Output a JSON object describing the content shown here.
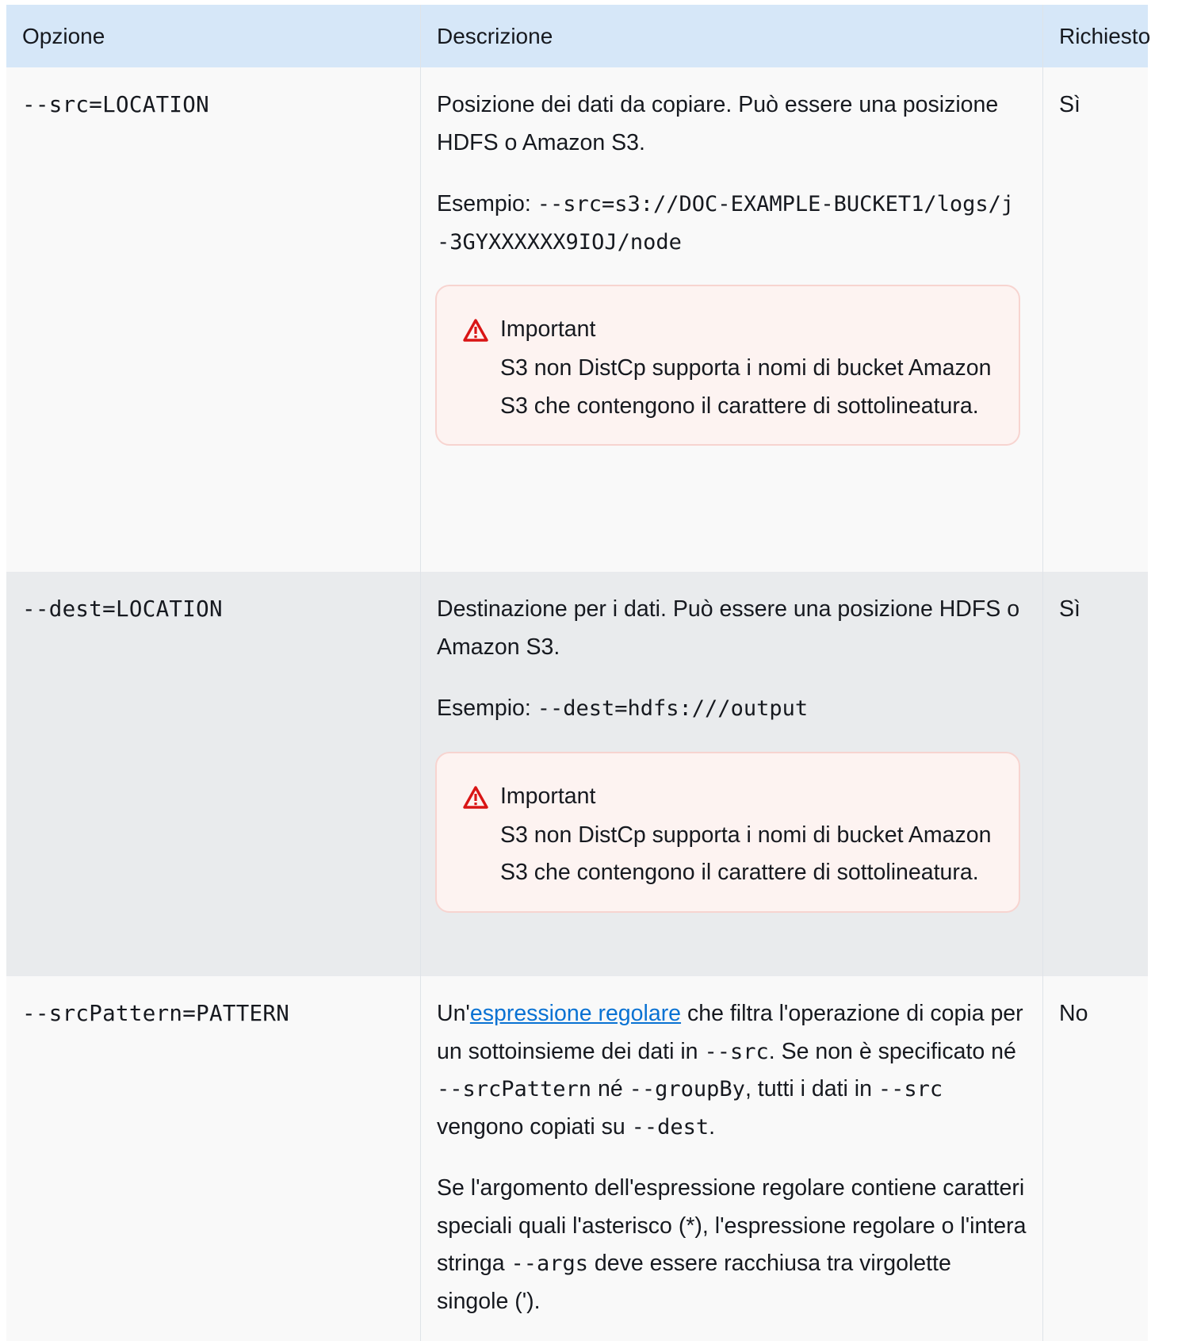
{
  "table": {
    "headers": {
      "option": "Opzione",
      "description": "Descrizione",
      "required": "Richiesto"
    },
    "rows": [
      {
        "option": "--src=LOCATION",
        "description": "Posizione dei dati da copiare. Può essere una posizione HDFS o Amazon S3.",
        "example_label": "Esempio: ",
        "example_code": "--src=s3://DOC-EXAMPLE-BUCKET1/logs/j-3GYXXXXXX9IOJ/node",
        "alert_title": "Important",
        "alert_text": "S3 non DistCp supporta i nomi di bucket Amazon S3 che contengono il carattere di sottolineatura.",
        "required": "Sì"
      },
      {
        "option": "--dest=LOCATION",
        "description": "Destinazione per i dati. Può essere una posizione HDFS o Amazon S3.",
        "example_label": "Esempio: ",
        "example_code": "--dest=hdfs:///output",
        "alert_title": "Important",
        "alert_text": "S3 non DistCp supporta i nomi di bucket Amazon S3 che contengono il carattere di sottolineatura.",
        "required": "Sì"
      },
      {
        "option": "--srcPattern=PATTERN",
        "desc_prefix": "Un'",
        "desc_link": "espressione regolare",
        "desc_mid1": " che filtra l'operazione di copia per un sottoinsieme dei dati in ",
        "code_src": "--src",
        "desc_mid2": ". Se non è specificato né ",
        "code_srcPattern": "--srcPattern",
        "desc_mid3": " né ",
        "code_groupBy": "--groupBy",
        "desc_mid4": ", tutti i dati in ",
        "desc_mid5": " vengono copiati su ",
        "code_dest": "--dest",
        "desc_end": ".",
        "para2_a": "Se l'argomento dell'espressione regolare contiene caratteri speciali quali l'asterisco (*), l'espressione regolare o l'intera stringa ",
        "code_args": "--args",
        "para2_b": " deve essere racchiusa tra virgolette singole (').",
        "required": "No"
      }
    ]
  },
  "icons": {
    "alert": "warning-triangle-icon"
  },
  "colors": {
    "header_bg": "#d6e7f8",
    "alert_bg": "#fdf3f1",
    "alert_border": "#f7d4d0",
    "alert_icon": "#d91515",
    "link": "#0972d3"
  }
}
